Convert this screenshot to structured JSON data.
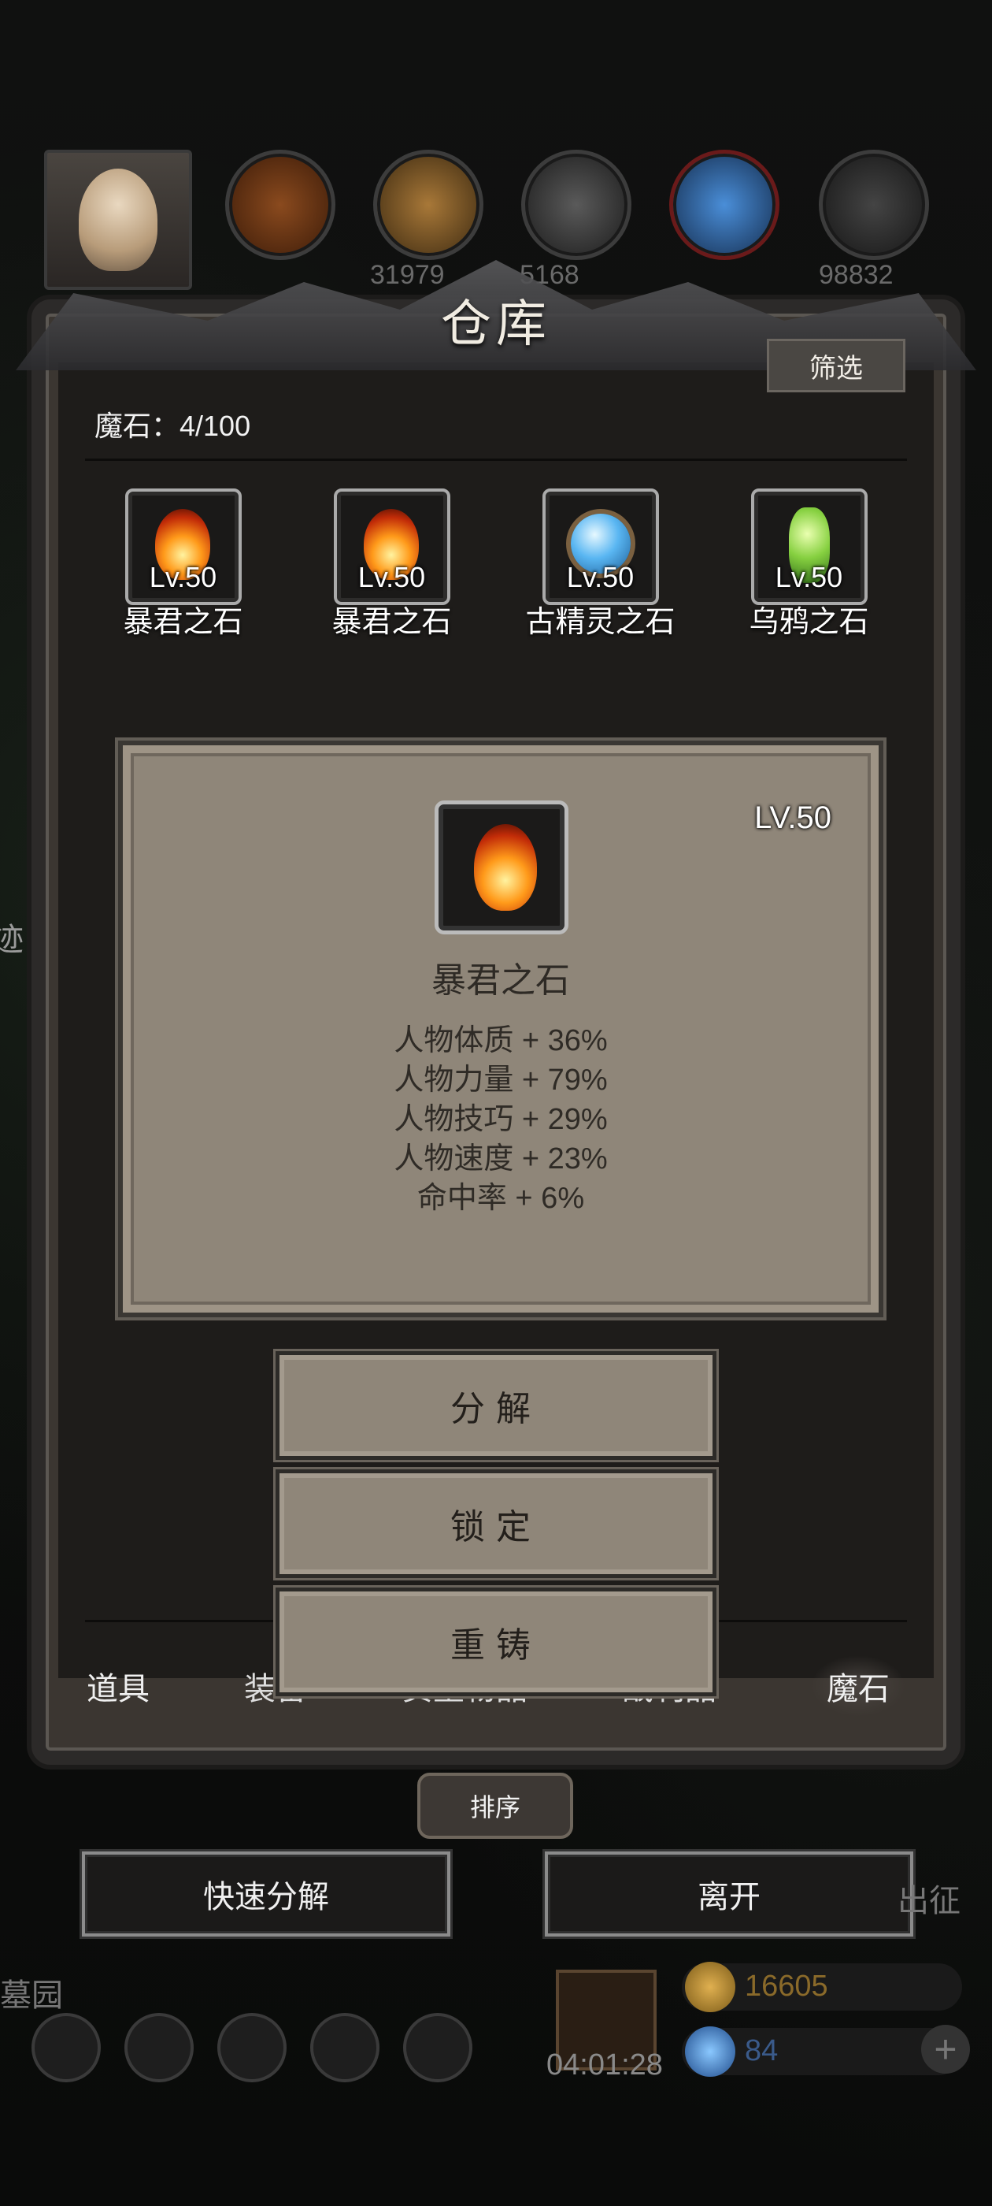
{
  "top_bar": {
    "resources": [
      {
        "name": "wood-resource",
        "value": ""
      },
      {
        "name": "plank-resource",
        "value": "31979"
      },
      {
        "name": "iron-resource",
        "value": "5168"
      },
      {
        "name": "crystal-resource",
        "value": ""
      },
      {
        "name": "steel-resource",
        "value": "98832"
      }
    ]
  },
  "side": {
    "left_char": "迹",
    "graveyard": "墓园",
    "expedition": "出征"
  },
  "warehouse": {
    "title": "仓库",
    "filter_label": "筛选",
    "capacity": "魔石：4/100",
    "items": [
      {
        "level": "Lv.50",
        "name": "暴君之石",
        "icon": "flame-stone-icon"
      },
      {
        "level": "Lv.50",
        "name": "暴君之石",
        "icon": "flame-stone-icon"
      },
      {
        "level": "Lv.50",
        "name": "古精灵之石",
        "icon": "blue-orb-icon"
      },
      {
        "level": "Lv.50",
        "name": "乌鸦之石",
        "icon": "green-crystal-icon"
      }
    ],
    "detail": {
      "level": "LV.50",
      "name": "暴君之石",
      "stats": [
        "人物体质 + 36%",
        "人物力量 + 79%",
        "人物技巧 + 29%",
        "人物速度 + 23%",
        "命中率 + 6%"
      ]
    },
    "actions": {
      "decompose": "分解",
      "lock": "锁定",
      "reforge": "重铸"
    },
    "tabs": [
      "道具",
      "装备",
      "贵重物品",
      "战利品",
      "魔石"
    ],
    "active_tab": "魔石",
    "sort_label": "排序"
  },
  "bottom": {
    "quick_decompose": "快速分解",
    "leave": "离开",
    "timer": "04:01:28",
    "gold": "16605",
    "gems": "84"
  },
  "colors": {
    "panel": "#8f8679",
    "frame": "#2c2a29",
    "accent_gold": "#b08a3a",
    "gem_blue": "#3a7bd5"
  }
}
